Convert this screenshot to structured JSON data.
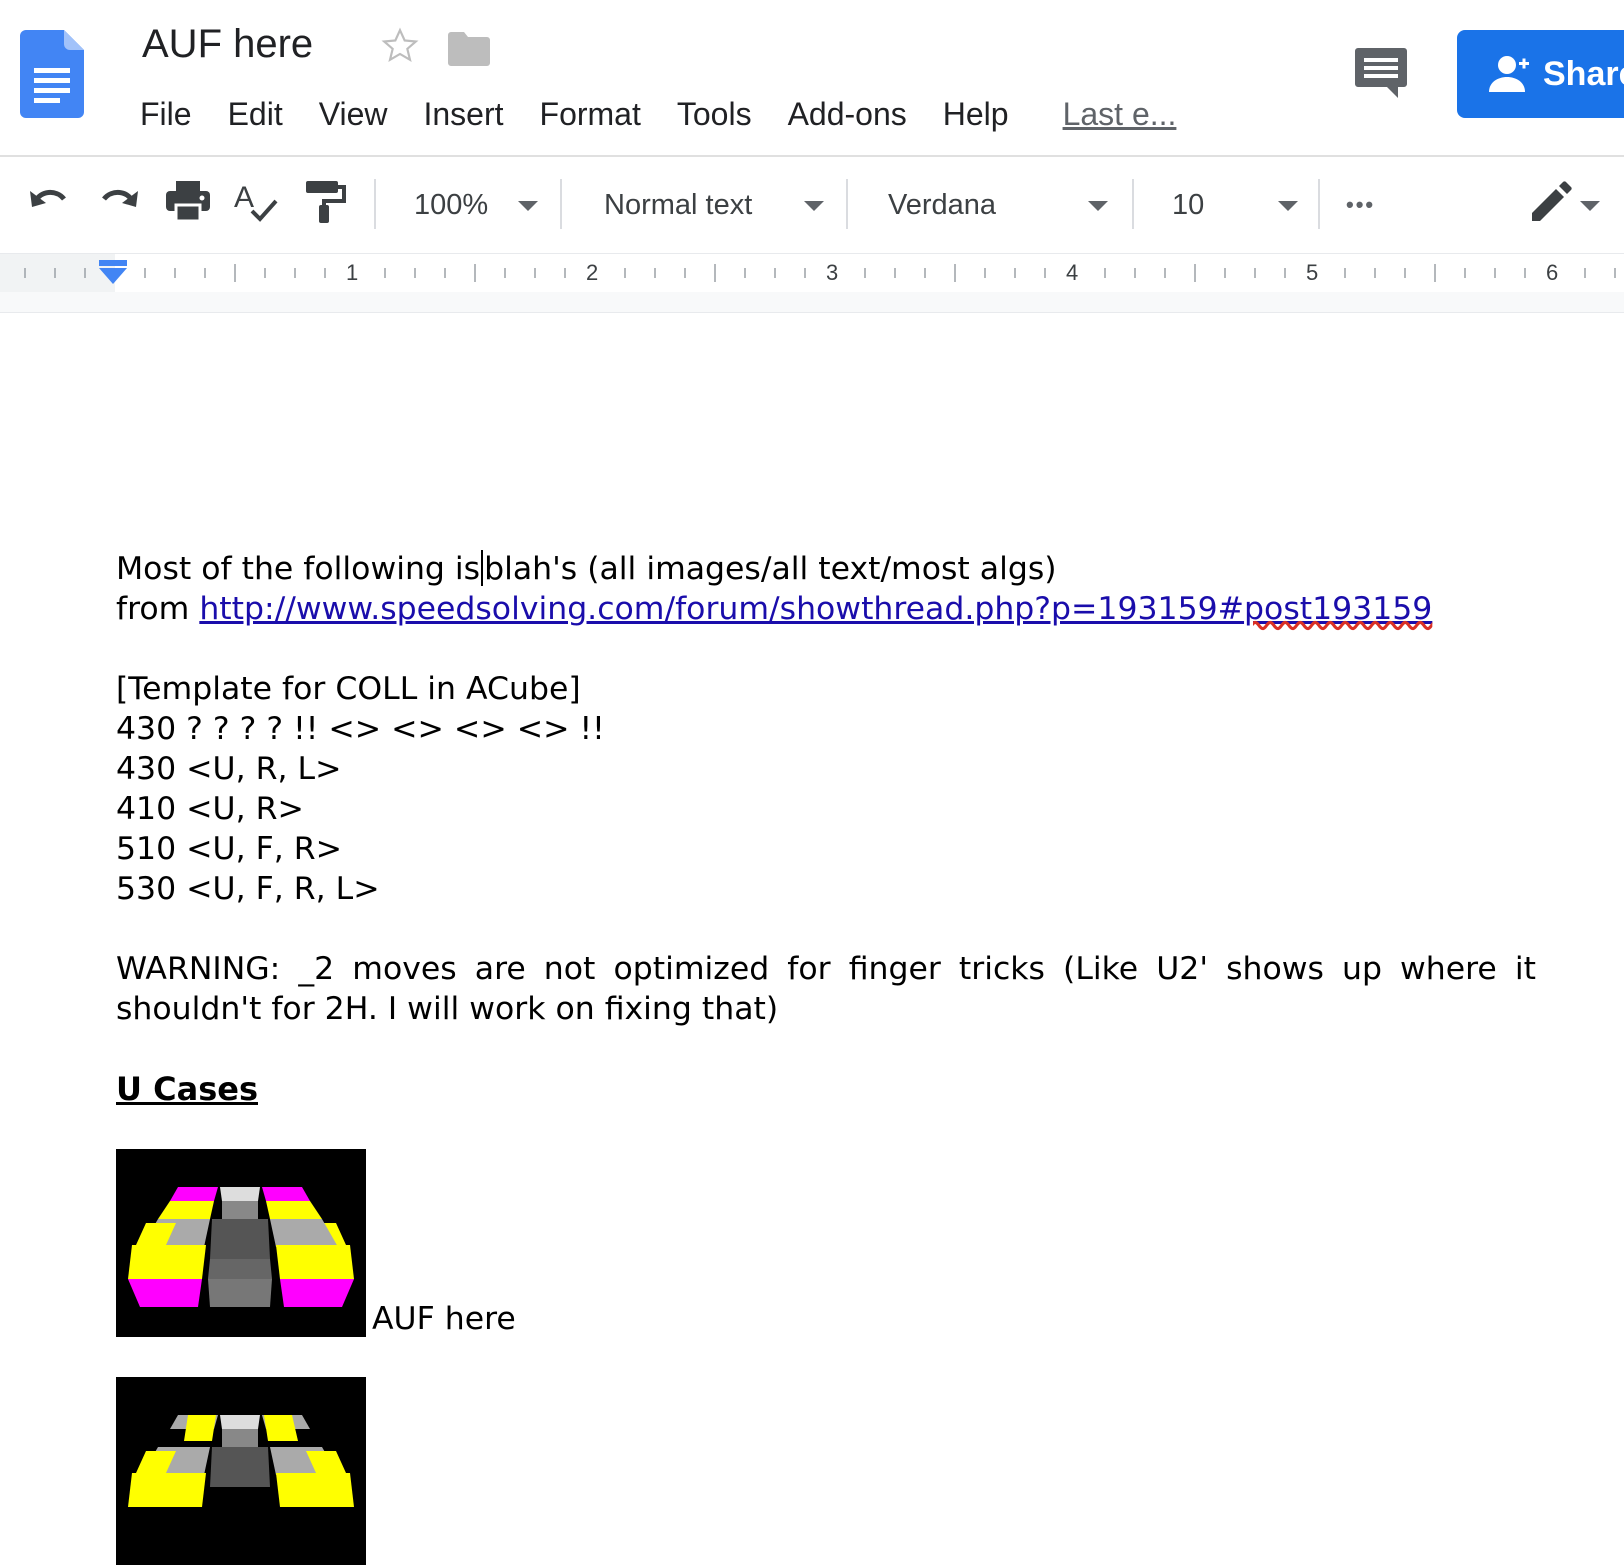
{
  "header": {
    "title": "AUF here",
    "menu": [
      "File",
      "Edit",
      "View",
      "Insert",
      "Format",
      "Tools",
      "Add-ons",
      "Help"
    ],
    "last_edit": "Last e...",
    "share_label": "Share"
  },
  "toolbar": {
    "zoom": "100%",
    "style": "Normal text",
    "font": "Verdana",
    "font_size": "10",
    "more": "•••"
  },
  "ruler": {
    "numbers": [
      "1",
      "2",
      "3",
      "4",
      "5",
      "6"
    ]
  },
  "document": {
    "intro_line1_a": "Most of the following is",
    "intro_line1_b": "blah's (all images/all text/most algs)",
    "intro_line2_prefix": "from ",
    "link_a": "http://www.speedsolving.com/forum/showthread.php?p=193159#",
    "link_b": "post193159",
    "template_lines": [
      "[Template for COLL in ACube]",
      "430 ? ? ? ? !! <> <> <> <> !!",
      "430 <U, R, L>",
      "410 <U, R>",
      "510 <U, F, R>",
      "530 <U, F, R, L>"
    ],
    "warning": "WARNING: _2 moves are not optimized for finger tricks (Like U2' shows up where it shouldn't for 2H. I will work on fixing that)",
    "heading": "U Cases",
    "case1_caption": "AUF here"
  },
  "colors": {
    "share_blue": "#1a73e8",
    "link": "#1a0dab",
    "cube_yellow": "#ffff00",
    "cube_magenta": "#ff00ff",
    "cube_gray": "#666666"
  }
}
